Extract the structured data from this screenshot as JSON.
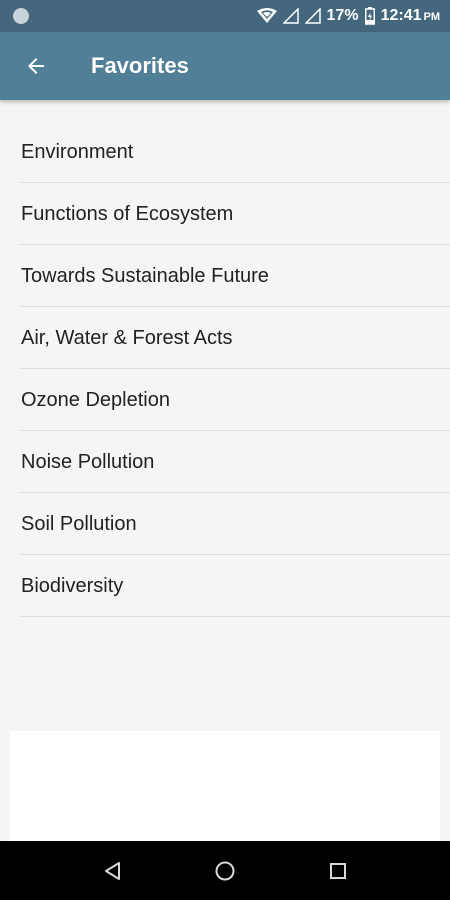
{
  "status_bar": {
    "battery_percent": "17%",
    "time": "12:41",
    "ampm": "PM",
    "icons": [
      "notification-dot-icon",
      "wifi-icon",
      "signal-icon",
      "signal-icon",
      "battery-icon"
    ]
  },
  "app_bar": {
    "title": "Favorites",
    "back_icon": "arrow-left-icon"
  },
  "favorites": [
    {
      "label": "Environment"
    },
    {
      "label": "Functions of Ecosystem"
    },
    {
      "label": "Towards Sustainable Future"
    },
    {
      "label": "Air, Water & Forest Acts"
    },
    {
      "label": "Ozone Depletion"
    },
    {
      "label": "Noise Pollution"
    },
    {
      "label": "Soil Pollution"
    },
    {
      "label": "Biodiversity"
    }
  ],
  "nav_bar": {
    "icons": [
      "nav-back-icon",
      "nav-home-icon",
      "nav-recents-icon"
    ]
  },
  "colors": {
    "status_bar": "#44677e",
    "app_bar": "#527f98",
    "background": "#f5f5f5",
    "nav_bar": "#000000"
  }
}
